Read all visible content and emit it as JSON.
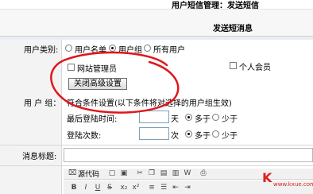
{
  "header": {
    "title": "用户短信管理：发送短信",
    "subtitle": "发送短消息"
  },
  "form": {
    "user_type": {
      "label": "用户类别:",
      "options": [
        {
          "label": "用户名单",
          "selected": false
        },
        {
          "label": "用户组",
          "selected": true
        },
        {
          "label": "所有用户",
          "selected": false
        }
      ]
    },
    "groups": [
      {
        "label": "网站管理员",
        "checked": false
      },
      {
        "label": "个人会员",
        "checked": false
      }
    ],
    "advanced_button": "关闭高级设置",
    "user_group_label": "用 户 组：",
    "condition_note": "符合条件设置(以下条件将对选择的用户组生效)",
    "last_login": {
      "label": "最后登陆时间:",
      "input_value": "",
      "unit": "天",
      "more": "多于",
      "less": "少于",
      "selected": "more"
    },
    "login_count": {
      "label": "登陆次数:",
      "input_value": "",
      "unit": "次",
      "more": "多于",
      "less": "少于",
      "selected": "more"
    },
    "message_title_label": "消息标题:"
  },
  "editor": {
    "source_label": "源代码",
    "toolbar_row1_icons": [
      "source-icon",
      "new-page-icon",
      "preview-icon",
      "cut-icon",
      "copy-icon",
      "paste-icon",
      "paste-text-icon",
      "paste-word-icon",
      "print-icon"
    ],
    "toolbar_row2_icons": [
      "bold-icon",
      "italic-icon",
      "underline-icon",
      "strike-icon",
      "subscript-icon",
      "superscript-icon",
      "ordered-list-icon",
      "unordered-list-icon",
      "outdent-icon",
      "indent-icon"
    ]
  },
  "watermark": {
    "text": "K",
    "caption": "www.kxue.com"
  },
  "colors": {
    "annotation": "#e2141b",
    "label_bg": "#f3f3f3"
  }
}
